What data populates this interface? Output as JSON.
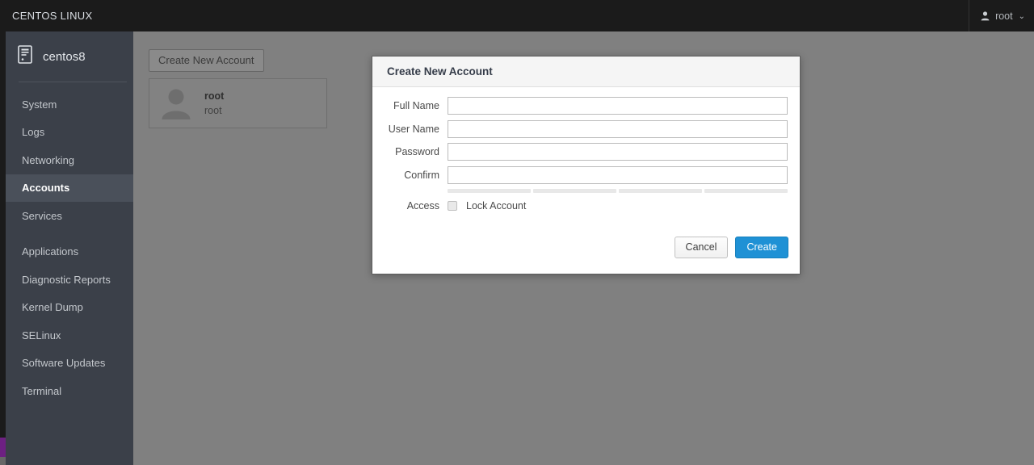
{
  "topbar": {
    "brand": "CENTOS LINUX",
    "user_icon": "user-icon",
    "user_name": "root",
    "caret": "⌄"
  },
  "sidebar": {
    "host_icon": "server-icon",
    "host_label": "centos8",
    "items": [
      {
        "label": "System",
        "active": false
      },
      {
        "label": "Logs",
        "active": false
      },
      {
        "label": "Networking",
        "active": false
      },
      {
        "label": "Accounts",
        "active": true
      },
      {
        "label": "Services",
        "active": false
      },
      {
        "label": "Applications",
        "active": false
      },
      {
        "label": "Diagnostic Reports",
        "active": false
      },
      {
        "label": "Kernel Dump",
        "active": false
      },
      {
        "label": "SELinux",
        "active": false
      },
      {
        "label": "Software Updates",
        "active": false
      },
      {
        "label": "Terminal",
        "active": false
      }
    ]
  },
  "main": {
    "create_account_button": "Create New Account",
    "account_card": {
      "avatar_icon": "person-avatar-icon",
      "full_name": "root",
      "user_name": "root"
    }
  },
  "modal": {
    "title": "Create New Account",
    "fields": [
      {
        "label": "Full Name",
        "value": "",
        "placeholder": ""
      },
      {
        "label": "User Name",
        "value": "",
        "placeholder": ""
      },
      {
        "label": "Password",
        "value": "",
        "placeholder": ""
      },
      {
        "label": "Confirm",
        "value": "",
        "placeholder": ""
      }
    ],
    "password_strength": {
      "segments": 4,
      "filled": 0
    },
    "access": {
      "label": "Access",
      "lock_account_label": "Lock Account",
      "lock_account_checked": false
    },
    "cancel_button": "Cancel",
    "create_button": "Create"
  },
  "colors": {
    "topbar_bg": "#1b1b1b",
    "sidebar_bg": "#3b4049",
    "sidebar_active_bg": "#4a505a",
    "main_bg": "#808080",
    "accent_purple": "#6d2082",
    "primary_button": "#1f91d5"
  }
}
